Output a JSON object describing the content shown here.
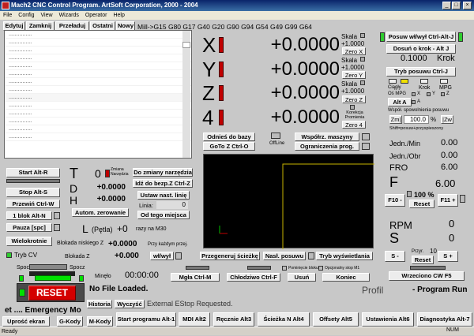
{
  "window": {
    "title": "Mach2 CNC Control Program. ArtSoft Corporation, 2000 - 2004",
    "minimize": "_",
    "maximize": "□",
    "close": "×"
  },
  "menu": [
    "File",
    "Config",
    "View",
    "Wizards",
    "Operator",
    "Help"
  ],
  "tabs": [
    "Edytuj",
    "Zamknij",
    "Przeładuj",
    "Ostatni",
    "Nowy"
  ],
  "modal_codes": "Mill->G15  G80 G17 G40 G20 G90 G94 G54 G49 G99 G64",
  "gcode_lines": [
    "...............",
    "...............",
    "...............",
    "...............",
    "...............",
    "...............",
    "...............",
    "...............",
    "...............",
    "...............",
    "...............",
    "...............",
    "...............",
    "..............."
  ],
  "axes": [
    {
      "letter": "X",
      "value": "+0.0000",
      "scale_label": "Skala",
      "scale": "+1.0000",
      "zero": "Zero X"
    },
    {
      "letter": "Y",
      "value": "+0.0000",
      "scale_label": "Skala",
      "scale": "+1.0000",
      "zero": "Zero Y"
    },
    {
      "letter": "Z",
      "value": "+0.0000",
      "scale_label": "Skala",
      "scale": "+1.0000",
      "zero": "Zero Z"
    },
    {
      "letter": "4",
      "value": "+0.0000",
      "scale_label": "Korekcja Promienia",
      "scale": "",
      "zero": "Zero 4"
    }
  ],
  "jog": {
    "toggle": "Posuw wł/wył Ctrl-Alt-J",
    "step": "Dosuń o krok - Alt J",
    "step_value": "0.1000",
    "step_unit": "Krok",
    "mode": "Tryb posuwu Ctrl-J",
    "c1": "Ciągły",
    "c2": "Krok",
    "c3": "MPG",
    "mpg_label": "Oś MPG",
    "alta": "Alt A",
    "x": "X",
    "y": "Y",
    "z": "Z",
    "a": "A",
    "feed_label": "Współ. spowolnienia posuwu",
    "zm": "Zm|",
    "pct": "100.0",
    "pct_sign": "%",
    "zw": "|Zw",
    "shift": "Shift=posuw+przyspieszony"
  },
  "center_buttons": {
    "ref": "Odnieś do bazy",
    "gotoz": "GoTo Z Ctrl-O",
    "offline": "OffLine",
    "machine": "Współrz. maszyny",
    "limits": "Ograniczenia prog."
  },
  "left_buttons": {
    "start": "Start Alt-R",
    "stop": "Stop Alt-S",
    "rewind": "Przewiń Ctrl-W",
    "single": "1 blok Alt-N",
    "pause": "Pauza [spc]",
    "multi": "Wielokrotnie",
    "tryb_cv": "Tryb CV",
    "blokada": "Blokada niskiego Z"
  },
  "tool": {
    "T": "T",
    "tool_num": "0",
    "zmiana": "Zmiana Narzędzia",
    "to_change": "Do zmiany narzędzia",
    "safe_z": "Idź do bezp.Z Ctrl-Z",
    "D": "D",
    "d_val": "+0.0000",
    "H": "H",
    "h_val": "+0.0000",
    "set_line": "Ustaw nast. linię",
    "linia": "Linia:",
    "linia_val": "0",
    "autom": "Autom. zerowanie",
    "from_here": "Od tego miejsca",
    "L": "L",
    "petla": "(Pętla)",
    "petla_val": "+0",
    "razy": "razy na M30",
    "blok_val": "+0.0000",
    "przy": "Przy każdym przej.",
    "blok2": "Blokada Z",
    "blok2_val": "+0.000",
    "wlwyl": "wł/wył"
  },
  "bottom_mid": {
    "regen": "Przegeneruj ścieżkę",
    "nasl": "Nasł. posuwu",
    "tryb_wys": "Tryb wyświetlania",
    "mgla": "Mgła Ctrl-M",
    "chlodz": "Chłodziwo Ctrl-F",
    "usun": "Usuń",
    "pomin": "Pominięcie bloku",
    "opcj": "Opcjonalny stop M1",
    "koniec": "Koniec"
  },
  "spindle": {
    "spocz1": "Spocz",
    "spocz2": "Spocz",
    "minelo": "Minęło",
    "time": "00:00:00",
    "no_file": "No File Loaded.",
    "profil": "Profil",
    "prog_run": "- Program Run"
  },
  "reset": "RESET",
  "emergency": "et .... Emergency Mo",
  "historia": "Historia",
  "wyczysc": "Wyczyść",
  "estop": "External EStop Requested.",
  "feed": {
    "jedn_min": "Jedn./Min",
    "jmin_val": "0.00",
    "jedn_obr": "Jedn./Obr",
    "jobr_val": "0.00",
    "fro": "FRO",
    "fro_val": "6.00",
    "F": "F",
    "f_val": "6.00",
    "f10m": "F10 -",
    "f_pct": "100 %",
    "f11p": "F11 +",
    "reset": "Reset"
  },
  "rpm": {
    "label": "RPM",
    "val": "0",
    "S": "S",
    "s_val": "0",
    "sminus": "S -",
    "przyr": "Przyr.",
    "przyr_val": "10",
    "sreset": "Reset",
    "splus": "S +",
    "cw": "Wrzeciono CW F5"
  },
  "bottom_tabs": [
    "Uprość ekran",
    "G-Kody",
    "M-Kody",
    "Start programu Alt-1",
    "MDI Alt2",
    "Ręcznie Alt3",
    "Ścieżka N Alt4",
    "Offsety Alt5",
    "Ustawienia Alt6",
    "Diagnostyka Alt-7"
  ],
  "status": {
    "ready": "Ready",
    "num": "NUM"
  }
}
